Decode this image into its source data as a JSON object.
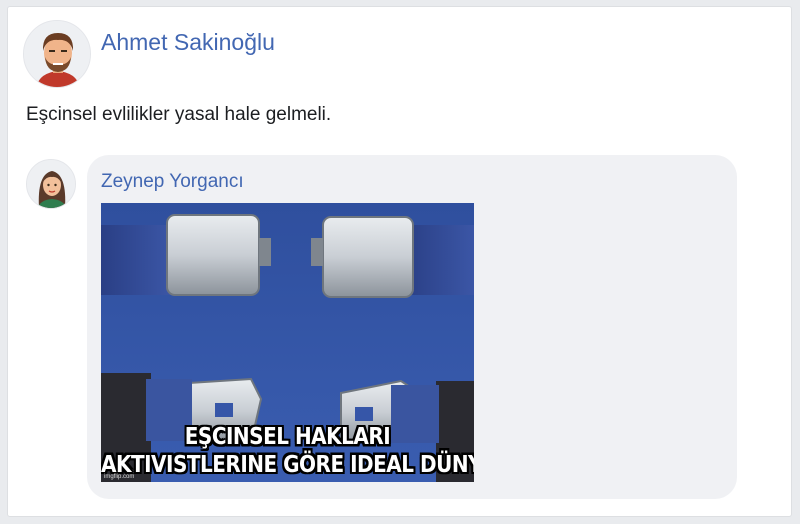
{
  "post": {
    "author": "Ahmet Sakinoğlu",
    "text": "Eşcinsel evlilikler yasal hale gelmeli.",
    "avatar_icon": "male-avatar-icon"
  },
  "reply": {
    "author": "Zeynep Yorgancı",
    "avatar_icon": "female-avatar-icon",
    "image": {
      "caption_line1": "EŞCINSEL HAKLARI",
      "caption_line2": "AKTIVISTLERINE GÖRE IDEAL DÜNYA.",
      "watermark": "imgflip.com"
    }
  },
  "colors": {
    "name_link": "#4267b2",
    "bubble": "#f0f1f4",
    "meme_background": "#3656a8"
  }
}
